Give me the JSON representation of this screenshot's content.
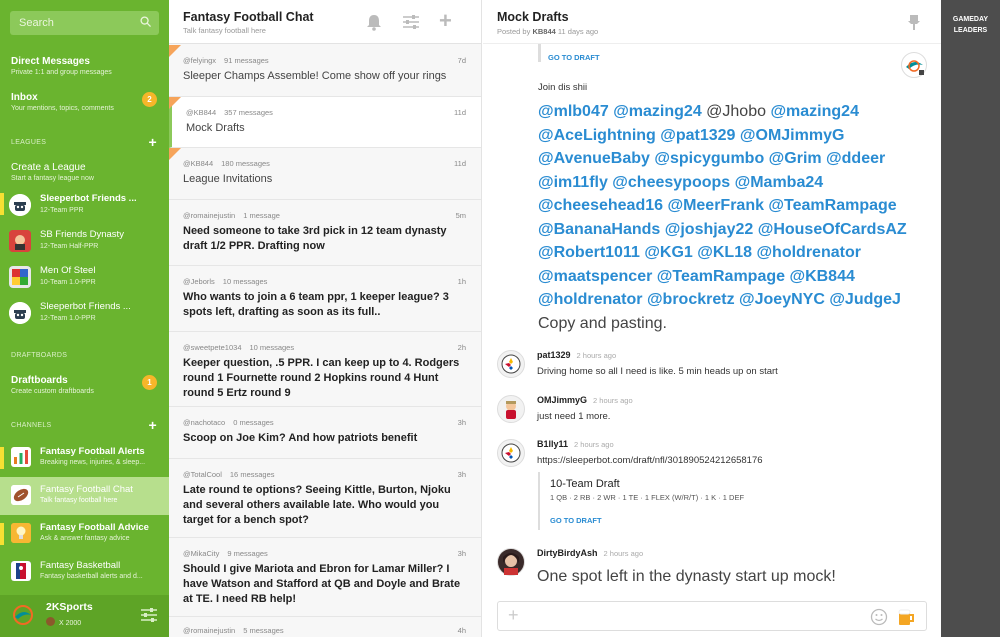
{
  "sidebar": {
    "search_placeholder": "Search",
    "direct_messages": {
      "title": "Direct Messages",
      "sub": "Private 1:1 and group messages"
    },
    "inbox": {
      "title": "Inbox",
      "sub": "Your mentions, topics, comments",
      "badge": "2"
    },
    "leagues_label": "LEAGUES",
    "create_league": {
      "title": "Create a League",
      "sub": "Start a fantasy league now"
    },
    "leagues": [
      {
        "title": "Sleeperbot Friends ...",
        "sub": "12-Team PPR"
      },
      {
        "title": "SB Friends Dynasty",
        "sub": "12-Team Half-PPR"
      },
      {
        "title": "Men Of Steel",
        "sub": "10-Team 1.0-PPR"
      },
      {
        "title": "Sleeperbot Friends ...",
        "sub": "12-Team 1.0-PPR"
      }
    ],
    "draftboards_label": "DRAFTBOARDS",
    "draftboards": {
      "title": "Draftboards",
      "sub": "Create custom draftboards",
      "badge": "1"
    },
    "channels_label": "CHANNELS",
    "channels": [
      {
        "title": "Fantasy Football Alerts",
        "sub": "Breaking news, injuries, & sleep..."
      },
      {
        "title": "Fantasy Football Chat",
        "sub": "Talk fantasy football here"
      },
      {
        "title": "Fantasy Football Advice",
        "sub": "Ask & answer fantasy advice"
      },
      {
        "title": "Fantasy Basketball",
        "sub": "Fantasy basketball alerts and d..."
      }
    ],
    "user": {
      "name": "2KSports",
      "coins": "X 2000"
    }
  },
  "middle": {
    "title": "Fantasy Football Chat",
    "subtitle": "Talk fantasy football here",
    "threads": [
      {
        "user": "@felyingx",
        "count": "91 messages",
        "time": "7d",
        "body": "Sleeper Champs Assemble! Come show off your rings"
      },
      {
        "user": "@KB844",
        "count": "357 messages",
        "time": "11d",
        "body": "Mock Drafts"
      },
      {
        "user": "@KB844",
        "count": "180 messages",
        "time": "11d",
        "body": "League Invitations"
      },
      {
        "user": "@romainejustin",
        "count": "1 message",
        "time": "5m",
        "body": "Need someone to take 3rd pick in 12 team dynasty draft 1/2 PPR. Drafting now"
      },
      {
        "user": "@Jeborls",
        "count": "10 messages",
        "time": "1h",
        "body": "Who wants to join a 6 team ppr, 1 keeper league? 3 spots left, drafting as soon as its full.."
      },
      {
        "user": "@sweetpete1034",
        "count": "10 messages",
        "time": "2h",
        "body": "Keeper question, .5 PPR. I can keep up to 4. Rodgers round 1 Fournette round 2 Hopkins round 4 Hunt round 5 Ertz round 9"
      },
      {
        "user": "@nachotaco",
        "count": "0 messages",
        "time": "3h",
        "body": "Scoop on Joe Kim? And how patriots benefit"
      },
      {
        "user": "@TotalCool",
        "count": "16 messages",
        "time": "3h",
        "body": "Late round te options? Seeing Kittle, Burton, Njoku and several others available late. Who would you target for a bench spot?"
      },
      {
        "user": "@MikaCity",
        "count": "9 messages",
        "time": "3h",
        "body": "Should I give Mariota and Ebron for Lamar Miller? I have Watson and Stafford at QB and Doyle and Brate at TE. I need RB help!"
      },
      {
        "user": "@romainejustin",
        "count": "5 messages",
        "time": "4h",
        "body": ""
      }
    ]
  },
  "right": {
    "title": "Mock Drafts",
    "posted_by_prefix": "Posted by",
    "posted_by_user": "KB844",
    "posted_ago": "11 days ago",
    "goto": "GO TO DRAFT",
    "join_text": "Join dis shii",
    "mentions_html_lines": [
      "@mlb047 @mazing24 @Jhobo @mazing24",
      "@AceLightning @pat1329 @OMJimmyG",
      "@AvenueBaby @spicygumbo @Grim @ddeer",
      "@im11fly @cheesypoops @Mamba24",
      "@cheesehead16 @MeerFrank @TeamRampage",
      "@BananaHands @joshjay22 @HouseOfCardsAZ",
      "@Robert1011 @KG1 @KL18 @holdrenator",
      "@maatspencer @TeamRampage @KB844",
      "@holdrenator @brockretz @JoeyNYC @JudgeJ"
    ],
    "copy_text": "Copy and pasting.",
    "messages": [
      {
        "user": "pat1329",
        "time": "2 hours ago",
        "text": "Driving home so all I need is like. 5 min heads up on start"
      },
      {
        "user": "OMJimmyG",
        "time": "2 hours ago",
        "text": "just need 1 more."
      },
      {
        "user": "B1lly11",
        "time": "2 hours ago",
        "text": "https://sleeperbot.com/draft/nfl/301890524212658176"
      },
      {
        "user": "DirtyBirdyAsh",
        "time": "2 hours ago",
        "text": "One spot left in the dynasty start up mock!"
      }
    ],
    "card": {
      "title": "10-Team Draft",
      "sub": "1 QB · 2 RB · 2 WR · 1 TE · 1 FLEX (W/R/T) · 1 K · 1 DEF",
      "goto": "GO TO DRAFT"
    }
  },
  "gameday": {
    "line1": "GAMEDAY",
    "line2": "LEADERS"
  }
}
